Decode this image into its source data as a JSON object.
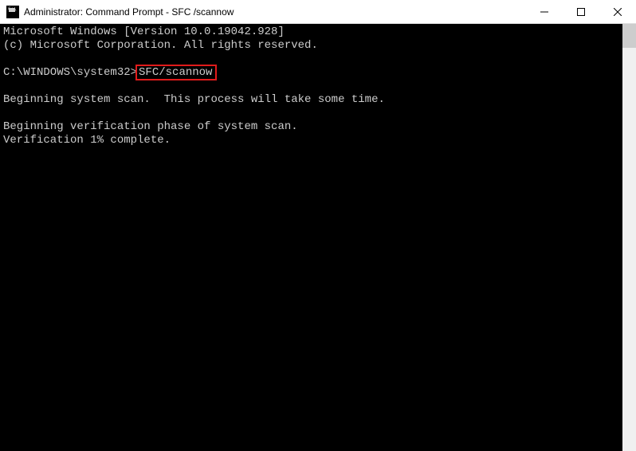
{
  "window": {
    "title": "Administrator: Command Prompt - SFC /scannow"
  },
  "terminal": {
    "line_version": "Microsoft Windows [Version 10.0.19042.928]",
    "line_copyright": "(c) Microsoft Corporation. All rights reserved.",
    "prompt_prefix": "C:\\WINDOWS\\system32>",
    "command": "SFC/scannow",
    "line_begin_scan": "Beginning system scan.  This process will take some time.",
    "line_verify_phase": "Beginning verification phase of system scan.",
    "line_verify_pct": "Verification 1% complete."
  }
}
